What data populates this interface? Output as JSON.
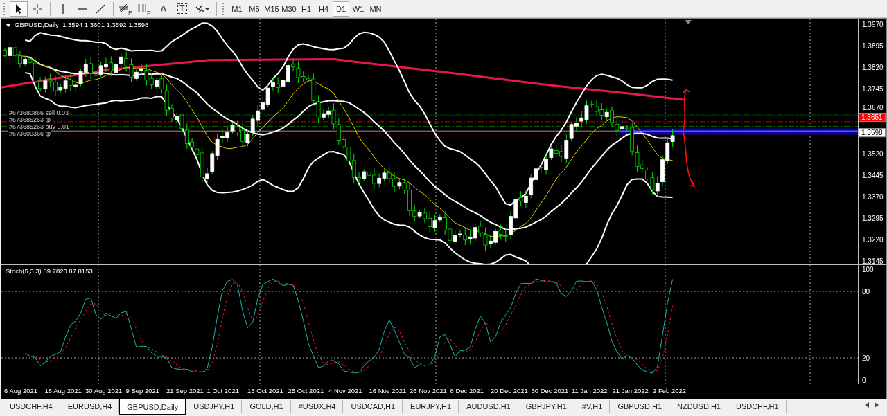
{
  "toolbar": {
    "tools": [
      {
        "kind": "cursor",
        "selected": true
      },
      {
        "kind": "crosshair",
        "selected": false
      },
      {
        "kind": "vline",
        "selected": false
      },
      {
        "kind": "hline",
        "selected": false
      },
      {
        "kind": "trendline",
        "selected": false
      },
      {
        "kind": "fibo",
        "label": "E",
        "selected": false
      },
      {
        "kind": "fibogrid",
        "label": "F",
        "selected": false
      },
      {
        "kind": "text",
        "label": "A",
        "selected": false
      },
      {
        "kind": "textlabel",
        "label": "T",
        "selected": false
      },
      {
        "kind": "arrows",
        "selected": false
      }
    ],
    "timeframes": [
      {
        "label": "M1",
        "selected": false
      },
      {
        "label": "M5",
        "selected": false
      },
      {
        "label": "M15",
        "selected": false
      },
      {
        "label": "M30",
        "selected": false
      },
      {
        "label": "H1",
        "selected": false
      },
      {
        "label": "H4",
        "selected": false
      },
      {
        "label": "D1",
        "selected": true
      },
      {
        "label": "W1",
        "selected": false
      },
      {
        "label": "MN",
        "selected": false
      }
    ]
  },
  "main_pane": {
    "symbol": "GBPUSD,Daily",
    "ohlc": "1.3594 1.3601 1.3592 1.3598",
    "order_labels": [
      "#673680866 sell 0.03",
      "#673685263 tp",
      "#673685263 buy 0.01",
      "#673600366 tp"
    ],
    "price_axis": [
      "1.3970",
      "1.3895",
      "1.3820",
      "1.3745",
      "1.3670",
      "1.3520",
      "1.3445",
      "1.3370",
      "1.3295",
      "1.3220",
      "1.3145"
    ],
    "price_badges": [
      {
        "label": "1.3651",
        "color": "#ff0000"
      },
      {
        "label": "1.3598",
        "color": "#ffffff"
      }
    ]
  },
  "stoch_pane": {
    "title": "Stoch(5,3,3) 89.7820 87.8153",
    "axis": [
      "100",
      "80",
      "20",
      "0"
    ]
  },
  "date_axis": [
    "6 Aug 2021",
    "18 Aug 2021",
    "30 Aug 2021",
    "9 Sep 2021",
    "21 Sep 2021",
    "1 Oct 2021",
    "13 Oct 2021",
    "25 Oct 2021",
    "4 Nov 2021",
    "16 Nov 2021",
    "26 Nov 2021",
    "8 Dec 2021",
    "20 Dec 2021",
    "30 Dec 2021",
    "11 Jan 2022",
    "21 Jan 2022",
    "2 Feb 2022"
  ],
  "tabs": [
    {
      "label": "USDCHF,H4",
      "selected": false
    },
    {
      "label": "EURUSD,H4",
      "selected": false
    },
    {
      "label": "GBPUSD,Daily",
      "selected": true
    },
    {
      "label": "USDJPY,H1",
      "selected": false
    },
    {
      "label": "GOLD,H1",
      "selected": false
    },
    {
      "label": "#USDX,H4",
      "selected": false
    },
    {
      "label": "USDCAD,H1",
      "selected": false
    },
    {
      "label": "EURJPY,H1",
      "selected": false
    },
    {
      "label": "AUDUSD,H1",
      "selected": false
    },
    {
      "label": "GBPJPY,H1",
      "selected": false
    },
    {
      "label": "#V,H1",
      "selected": false
    },
    {
      "label": "GBPUSD,H1",
      "selected": false
    },
    {
      "label": "NZDUSD,H1",
      "selected": false
    },
    {
      "label": "USDCHF,H1",
      "selected": false
    }
  ]
}
